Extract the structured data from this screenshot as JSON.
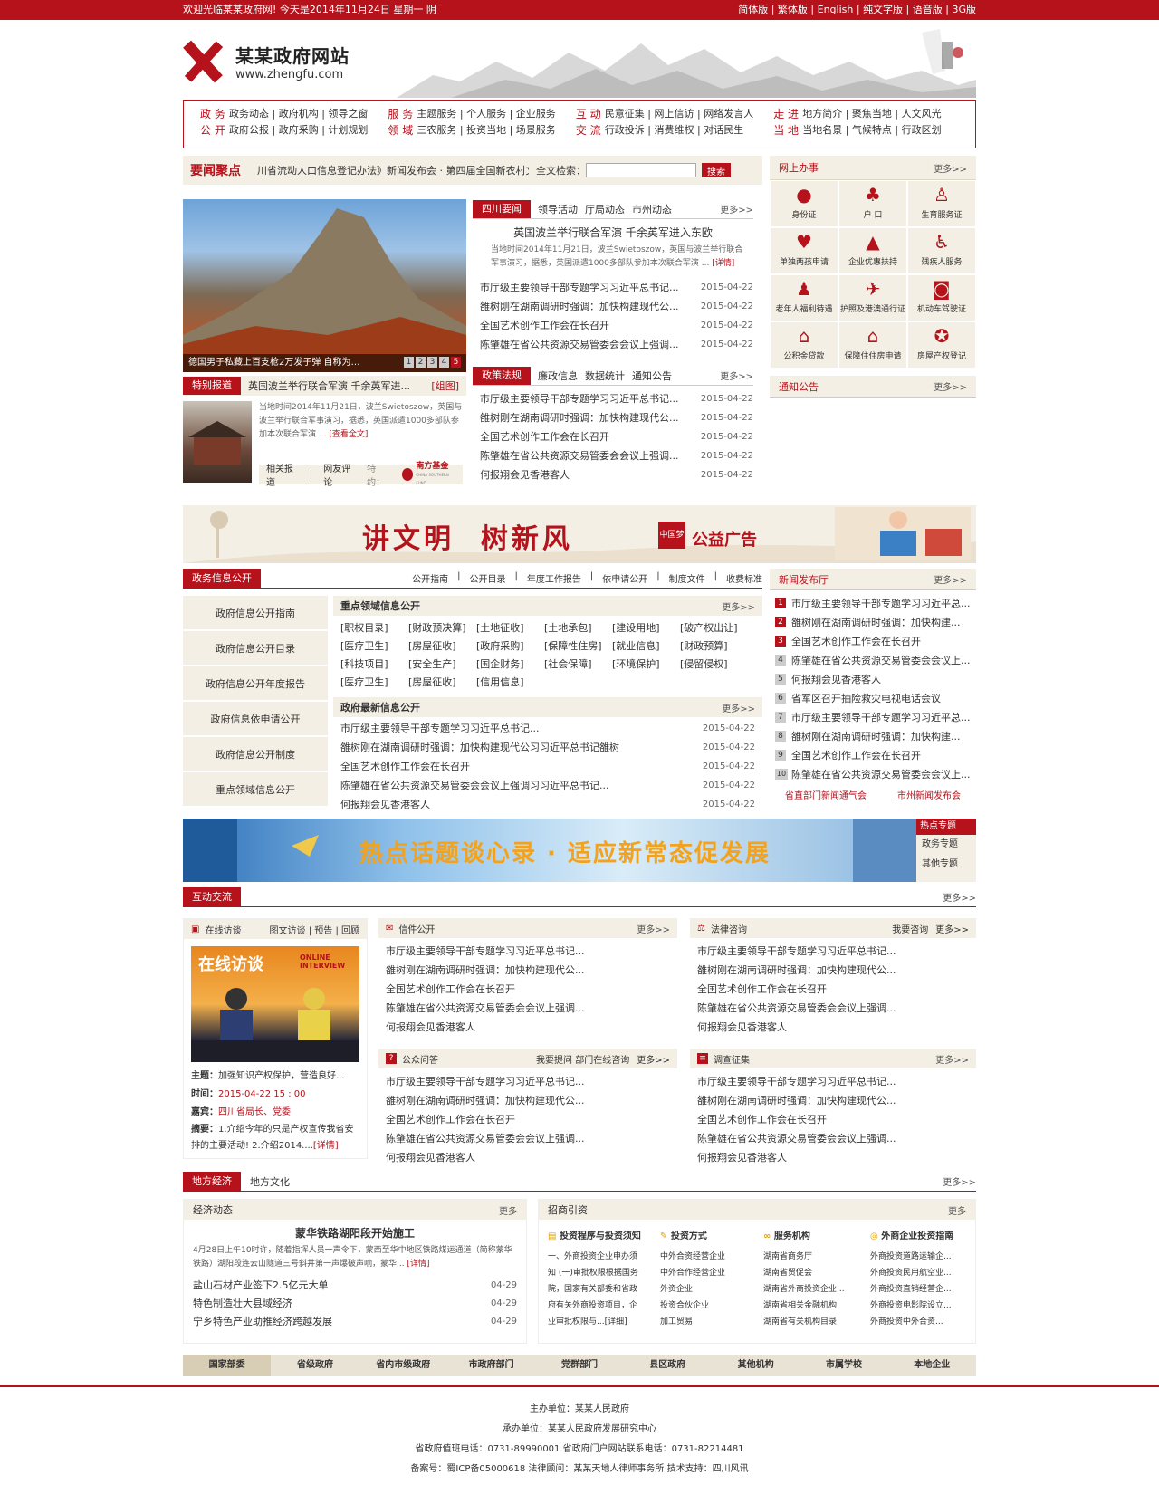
{
  "topbar": {
    "welcome": "欢迎光临某某政府网! 今天是2014年11月24日  星期一  阴",
    "links": [
      "简体版",
      "繁体版",
      "English",
      "纯文字版",
      "语音版",
      "3G版"
    ]
  },
  "logo": {
    "name": "某某政府网站",
    "url": "www.zhengfu.com"
  },
  "nav": [
    {
      "label1": "政 务",
      "label2": "公 开",
      "row1": "政务动态 | 政府机构 | 领导之窗",
      "row2": "政府公报 | 政府采购 | 计划规划"
    },
    {
      "label1": "服 务",
      "label2": "领 域",
      "row1": "主题服务 | 个人服务 | 企业服务",
      "row2": "三农服务 | 投资当地 | 场景服务"
    },
    {
      "label1": "互 动",
      "label2": "交 流",
      "row1": "民意征集 | 网上信访 | 网络发言人",
      "row2": "行政投诉 | 消费维权 | 对话民生"
    },
    {
      "label1": "走 进",
      "label2": "当 地",
      "row1": "地方简介 | 聚焦当地 | 人文风光",
      "row2": "当地名景 | 气候特点 | 行政区划"
    }
  ],
  "headline": {
    "label": "要闻聚点",
    "ticker": "川省流动人口信息登记办法》新闻发布会 · 第四届全国新农村文化",
    "search_label": "全文检索：",
    "search_placeholder": "",
    "search_button": "搜索"
  },
  "slideshow": {
    "caption": "德国男子私藏上百支枪2万发子弹 自称为…",
    "pages": [
      "1",
      "2",
      "3",
      "4",
      "5"
    ]
  },
  "special": {
    "tab": "特别报道",
    "title": "英国波兰举行联合军演 千余英军进...",
    "tag": "[组图]",
    "summary": "当地时间2014年11月21日，波兰Swietoszow，英国与波兰举行联合军事演习，据悉，英国派遣1000多部队参加本次联合军演 ...",
    "more": "[查看全文]",
    "links": [
      "相关报道",
      "网友评论"
    ],
    "sponsor": "特约：",
    "sponsor_name": "南方基金",
    "sponsor_en": "CHINA SOUTHERN FUND"
  },
  "news_tabs": {
    "tabs": [
      "四川要闻",
      "领导活动",
      "厅局动态",
      "市州动态"
    ],
    "more": "更多>>",
    "feature_title": "英国波兰举行联合军演 千余英军进入东欧",
    "feature_text": "当地时间2014年11月21日，波兰Swietoszow，英国与波兰举行联合军事演习，据悉，英国派遣1000多部队参加本次联合军演 ...",
    "feature_more": "[详情]",
    "items": [
      {
        "t": "市厅级主要领导干部专题学习习近平总书记...",
        "d": "2015-04-22"
      },
      {
        "t": "雒树刚在湖南调研时强调：加快构建现代公...",
        "d": "2015-04-22"
      },
      {
        "t": "全国艺术创作工作会在长召开",
        "d": "2015-04-22"
      },
      {
        "t": "陈肇雄在省公共资源交易管委会会议上强调...",
        "d": "2015-04-22"
      }
    ]
  },
  "policy_tabs": {
    "tabs": [
      "政策法规",
      "廉政信息",
      "数据统计",
      "通知公告"
    ],
    "more": "更多>>",
    "items": [
      {
        "t": "市厅级主要领导干部专题学习习近平总书记...",
        "d": "2015-04-22"
      },
      {
        "t": "雒树刚在湖南调研时强调：加快构建现代公...",
        "d": "2015-04-22"
      },
      {
        "t": "全国艺术创作工作会在长召开",
        "d": "2015-04-22"
      },
      {
        "t": "陈肇雄在省公共资源交易管委会会议上强调...",
        "d": "2015-04-22"
      },
      {
        "t": "何报翔会见香港客人",
        "d": "2015-04-22"
      }
    ]
  },
  "online_services": {
    "title": "网上办事",
    "more": "更多>>",
    "items": [
      "身份证",
      "户 口",
      "生育服务证",
      "单独两孩申请",
      "企业优惠扶持",
      "残疾人服务",
      "老年人福利待遇",
      "护照及港澳通行证",
      "机动车驾驶证",
      "公积金贷款",
      "保障住住房申请",
      "房屋产权登记"
    ]
  },
  "notice": {
    "title": "通知公告",
    "more": "更多>>"
  },
  "banner1": {
    "slogan": "讲文明  树新风",
    "badge": "中国梦",
    "label": "公益广告"
  },
  "govinfo": {
    "tab": "政务信息公开",
    "links": [
      "公开指南",
      "公开目录",
      "年度工作报告",
      "依申请公开",
      "制度文件",
      "收费标准"
    ],
    "side": [
      "政府信息公开指南",
      "政府信息公开目录",
      "政府信息公开年度报告",
      "政府信息依申请公开",
      "政府信息公开制度",
      "重点领域信息公开"
    ],
    "key_title": "重点领域信息公开",
    "key_more": "更多>>",
    "tags": [
      "[职权目录]",
      "[财政预决算]",
      "[土地征收]",
      "[土地承包]",
      "[建设用地]",
      "[破产权出让]",
      "[医疗卫生]",
      "[房屋征收]",
      "[政府采购]",
      "[保障性住房]",
      "[就业信息]",
      "[财政预算]",
      "[科技项目]",
      "[安全生产]",
      "[国企财务]",
      "[社会保障]",
      "[环境保护]",
      "[侵留侵权]",
      "[医疗卫生]",
      "[房屋征收]",
      "[信用信息]"
    ],
    "latest_title": "政府最新信息公开",
    "latest_more": "更多>>",
    "latest": [
      {
        "t": "市厅级主要领导干部专题学习习近平总书记...",
        "d": "2015-04-22"
      },
      {
        "t": "雒树刚在湖南调研时强调：加快构建现代公习习近平总书记雒树",
        "d": "2015-04-22"
      },
      {
        "t": "全国艺术创作工作会在长召开",
        "d": "2015-04-22"
      },
      {
        "t": "陈肇雄在省公共资源交易管委会会议上强调习习近平总书记...",
        "d": "2015-04-22"
      },
      {
        "t": "何报翔会见香港客人",
        "d": "2015-04-22"
      }
    ]
  },
  "press": {
    "title": "新闻发布厅",
    "more": "更多>>",
    "items": [
      "市厅级主要领导干部专题学习习近平总...",
      "雒树刚在湖南调研时强调：加快构建...",
      "全国艺术创作工作会在长召开",
      "陈肇雄在省公共资源交易管委会会议上...",
      "何报翔会见香港客人",
      "省军区召开抽险救灾电视电话会议",
      "市厅级主要领导干部专题学习习近平总...",
      "雒树刚在湖南调研时强调：加快构建...",
      "全国艺术创作工作会在长召开",
      "陈肇雄在省公共资源交易管委会会议上..."
    ],
    "foot1": "省直部门新闻通气会",
    "foot2": "市州新闻发布会"
  },
  "banner2": {
    "slogan": "热点话题谈心录 · 适应新常态促发展",
    "side_title": "热点专题",
    "side_links": [
      "政务专题",
      "其他专题"
    ]
  },
  "interact": {
    "tab": "互动交流",
    "more": "更多>>",
    "interview": {
      "title": "在线访谈",
      "links": "图文访谈 | 预告 | 回顾",
      "img_cn": "在线访谈",
      "img_en1": "ONLINE",
      "img_en2": "INTERVIEW",
      "topic_l": "主题：",
      "topic": "加强知识产权保护，营造良好...",
      "time_l": "时间：",
      "time": "2015-04-22  15 : 00",
      "guest_l": "嘉宾：",
      "guest": "四川省局长、党委",
      "sum_l": "摘要：",
      "sum": "1.介绍今年的只是产权宣传我省安排的主要活动! 2.介绍2014....",
      "detail": "[详情]"
    },
    "boxes": [
      {
        "title": "信件公开",
        "extra": "",
        "more": "更多>>",
        "items": [
          "市厅级主要领导干部专题学习习近平总书记...",
          "雒树刚在湖南调研时强调：加快构建现代公...",
          "全国艺术创作工作会在长召开",
          "陈肇雄在省公共资源交易管委会会议上强调...",
          "何报翔会见香港客人"
        ]
      },
      {
        "title": "法律咨询",
        "extra": "我要咨询",
        "more": "更多>>",
        "items": [
          "市厅级主要领导干部专题学习习近平总书记...",
          "雒树刚在湖南调研时强调：加快构建现代公...",
          "全国艺术创作工作会在长召开",
          "陈肇雄在省公共资源交易管委会会议上强调...",
          "何报翔会见香港客人"
        ]
      },
      {
        "title": "公众问答",
        "extra": "我要提问  部门在线咨询",
        "more": "更多>>",
        "items": [
          "市厅级主要领导干部专题学习习近平总书记...",
          "雒树刚在湖南调研时强调：加快构建现代公...",
          "全国艺术创作工作会在长召开",
          "陈肇雄在省公共资源交易管委会会议上强调...",
          "何报翔会见香港客人"
        ]
      },
      {
        "title": "调查征集",
        "extra": "",
        "more": "更多>>",
        "items": [
          "市厅级主要领导干部专题学习习近平总书记...",
          "雒树刚在湖南调研时强调：加快构建现代公...",
          "全国艺术创作工作会在长召开",
          "陈肇雄在省公共资源交易管委会会议上强调...",
          "何报翔会见香港客人"
        ]
      }
    ]
  },
  "economy": {
    "tabs": [
      "地方经济",
      "地方文化"
    ],
    "more": "更多>>",
    "dyn_title": "经济动态",
    "dyn_more": "更多",
    "feature_title": "蒙华铁路湖阳段开始施工",
    "feature_text": "4月28日上午10时许，随着指挥人员一声令下，蒙西至华中地区铁路煤运通道（简称蒙华铁路）湖阳段连云山隧道三号斜井第一声爆破声响，蒙华...",
    "feature_more": "[详情]",
    "items": [
      {
        "t": "盐山石材产业签下2.5亿元大单",
        "d": "04-29"
      },
      {
        "t": "特色制造壮大县域经济",
        "d": "04-29"
      },
      {
        "t": "宁乡特色产业助推经济跨越发展",
        "d": "04-29"
      }
    ],
    "invest_title": "招商引资",
    "invest_more": "更多",
    "cols": [
      {
        "title": "投资程序与投资须知",
        "items": [
          "一、外商投资企业申办须",
          "知 (一)审批权限根据国务",
          "院，国家有关部委和省政",
          "府有关外商投资项目，企",
          "业审批权限与...[详细]"
        ]
      },
      {
        "title": "投资方式",
        "items": [
          "中外合资经营企业",
          "中外合作经营企业",
          "外资企业",
          "投资合伙企业",
          "加工贸易"
        ]
      },
      {
        "title": "服务机构",
        "items": [
          "湖南省商务厅",
          "湖南省贸促会",
          "湖南省外商投资企业...",
          "湖南省相关金融机构",
          "湖南省有关机构目录"
        ]
      },
      {
        "title": "外商企业投资指南",
        "items": [
          "外商投资道路运输企...",
          "外商投资民用航空业...",
          "外商投资直销经营企...",
          "外商投资电影院设立...",
          "外商投资中外合资..."
        ]
      }
    ]
  },
  "linkbar": [
    "国家部委",
    "省级政府",
    "省内市级政府",
    "市政府部门",
    "党群部门",
    "县区政府",
    "其他机构",
    "市属学校",
    "本地企业"
  ],
  "footer": {
    "l1": "主办单位：某某人民政府",
    "l2": "承办单位：某某人民政府发展研究中心",
    "l3": "省政府值班电话：0731-89990001  省政府门户网站联系电话：0731-82214481",
    "l4": "备案号：蜀ICP备05000618  法律顾问：某某天地人律师事务所  技术支持：四川风讯"
  },
  "colors": {
    "brand_red": "#b5121b",
    "beige": "#f4efe4"
  }
}
